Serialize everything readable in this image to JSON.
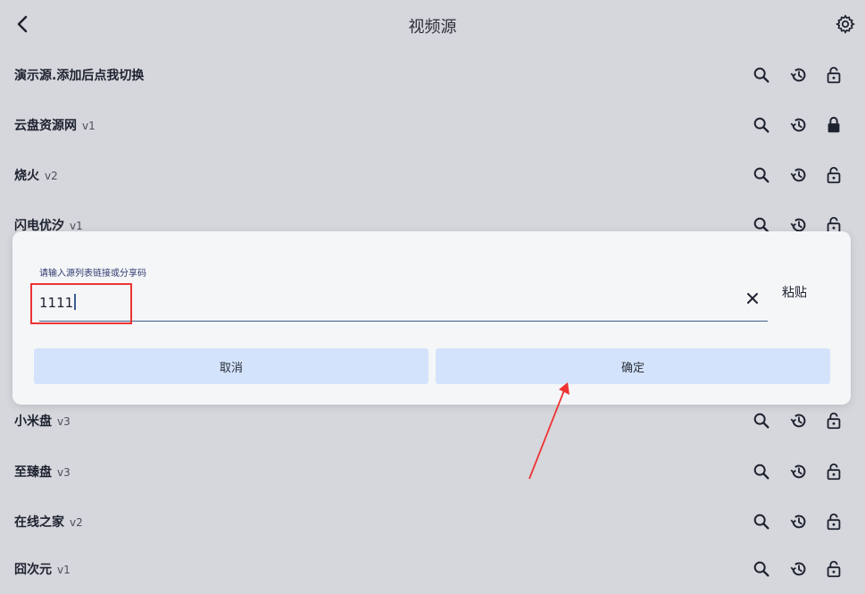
{
  "header": {
    "title": "视频源",
    "back_icon": "chevron-left-icon",
    "settings_icon": "gear-icon"
  },
  "sources": [
    {
      "name": "演示源.添加后点我切换",
      "version": "",
      "locked": false
    },
    {
      "name": "云盘资源网",
      "version": "v1",
      "locked": true
    },
    {
      "name": "烧火",
      "version": "v2",
      "locked": false
    },
    {
      "name": "闪电优汐",
      "version": "v1",
      "locked": false
    },
    {
      "name": "小米盘",
      "version": "v3",
      "locked": false
    },
    {
      "name": "至臻盘",
      "version": "v3",
      "locked": false
    },
    {
      "name": "在线之家",
      "version": "v2",
      "locked": false
    },
    {
      "name": "囧次元",
      "version": "v1",
      "locked": false
    }
  ],
  "dialog": {
    "label": "请输入源列表链接或分享码",
    "value": "1111",
    "paste_label": "粘贴",
    "cancel_label": "取消",
    "confirm_label": "确定"
  },
  "colors": {
    "background": "#d6d7dc",
    "dialog": "#f5f6f8",
    "button": "#d3e3fb",
    "underline": "#3a5e8c",
    "annotation": "#ee3333"
  }
}
